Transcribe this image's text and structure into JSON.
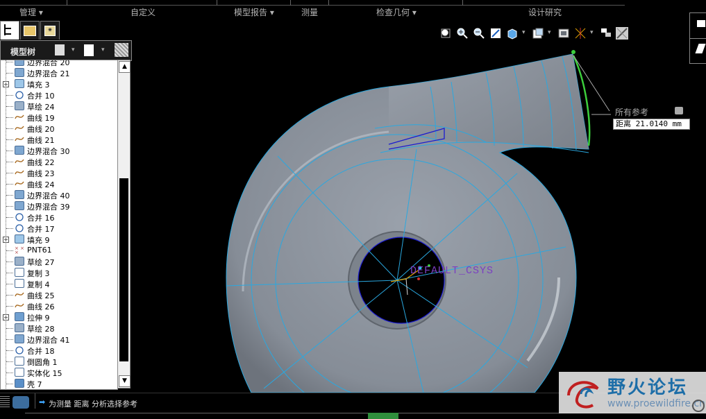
{
  "menu": {
    "items": [
      "管理",
      "自定义",
      "模型报告",
      "测量",
      "检查几何",
      "设计研究"
    ]
  },
  "panel": {
    "title": "模型树",
    "rows": [
      {
        "label": "边界混合 20",
        "icon": "boundary-blend",
        "expand": false
      },
      {
        "label": "边界混合 21",
        "icon": "boundary-blend",
        "expand": false
      },
      {
        "label": "填充 3",
        "icon": "fill",
        "expand": true
      },
      {
        "label": "合并 10",
        "icon": "merge",
        "expand": false
      },
      {
        "label": "草绘 24",
        "icon": "sketch",
        "expand": false
      },
      {
        "label": "曲线 19",
        "icon": "curve",
        "expand": false
      },
      {
        "label": "曲线 20",
        "icon": "curve",
        "expand": false
      },
      {
        "label": "曲线 21",
        "icon": "curve",
        "expand": false
      },
      {
        "label": "边界混合 30",
        "icon": "boundary-blend",
        "expand": false
      },
      {
        "label": "曲线 22",
        "icon": "curve",
        "expand": false
      },
      {
        "label": "曲线 23",
        "icon": "curve",
        "expand": false
      },
      {
        "label": "曲线 24",
        "icon": "curve",
        "expand": false
      },
      {
        "label": "边界混合 40",
        "icon": "boundary-blend",
        "expand": false
      },
      {
        "label": "边界混合 39",
        "icon": "boundary-blend",
        "expand": false
      },
      {
        "label": "合并 16",
        "icon": "merge",
        "expand": false
      },
      {
        "label": "合并 17",
        "icon": "merge",
        "expand": false
      },
      {
        "label": "填充 9",
        "icon": "fill",
        "expand": true
      },
      {
        "label": "PNT61",
        "icon": "datum-point",
        "expand": false
      },
      {
        "label": "草绘 27",
        "icon": "sketch",
        "expand": false
      },
      {
        "label": "复制 3",
        "icon": "copy",
        "expand": false
      },
      {
        "label": "复制 4",
        "icon": "copy",
        "expand": false
      },
      {
        "label": "曲线 25",
        "icon": "curve",
        "expand": false
      },
      {
        "label": "曲线 26",
        "icon": "curve",
        "expand": false
      },
      {
        "label": "拉伸 9",
        "icon": "extrude",
        "expand": true
      },
      {
        "label": "草绘 28",
        "icon": "sketch",
        "expand": false
      },
      {
        "label": "边界混合 41",
        "icon": "boundary-blend",
        "expand": false
      },
      {
        "label": "合并 18",
        "icon": "merge",
        "expand": false
      },
      {
        "label": "倒圆角 1",
        "icon": "round",
        "expand": false
      },
      {
        "label": "实体化 15",
        "icon": "solidify",
        "expand": false
      },
      {
        "label": "壳 7",
        "icon": "shell",
        "expand": false
      }
    ]
  },
  "toolbar": {
    "icons": [
      "zoom-fit-icon",
      "zoom-in-icon",
      "zoom-out-icon",
      "repaint-icon",
      "display-style-icon",
      "saved-views-icon",
      "view-manager-icon",
      "datum-display-icon",
      "spin-center-icon",
      "model-display-icon"
    ]
  },
  "measure": {
    "label": "所有参考",
    "value": "距离 21.0140 mm"
  },
  "viewport": {
    "csys_label": "DEFAULT_CSYS"
  },
  "status": {
    "message": "为测量 距离 分析选择参考"
  },
  "watermark": {
    "name": "野火论坛",
    "url": "www.proewildfire.cn"
  },
  "colors": {
    "model": "#8a919b",
    "edge": "#2aa8e0",
    "csys": "#7b3fc2"
  }
}
